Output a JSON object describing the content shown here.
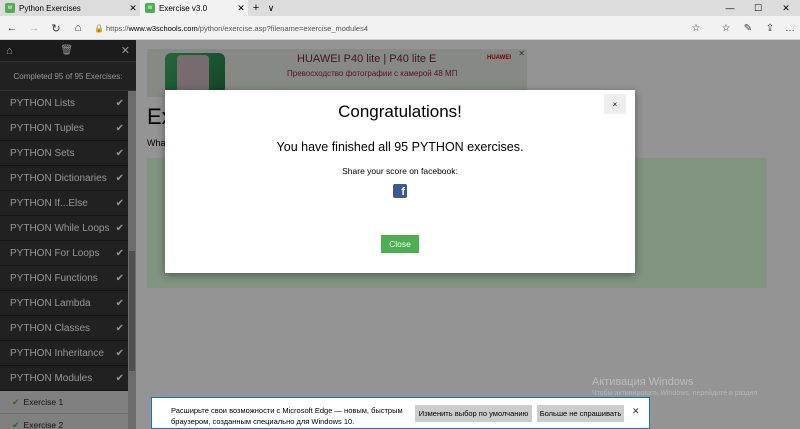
{
  "browser": {
    "tabs": [
      {
        "label": "Python Exercises",
        "favicon_color": "#4CAF50"
      },
      {
        "label": "Exercise v3.0",
        "favicon_color": "#4CAF50"
      }
    ],
    "new_tab": "+",
    "tab_list": "∨",
    "window_controls": [
      "—",
      "☐",
      "✕"
    ],
    "url_prefix": "https://",
    "url_domain": "www.w3schools.com",
    "url_path": "/python/exercise.asp?filename=exercise_modules4",
    "nav_icons": [
      "←",
      "→",
      "↻",
      "⌂"
    ],
    "toolbar_icons": [
      "☆",
      "☆",
      "✎",
      "⇪",
      "…"
    ]
  },
  "sidebar": {
    "home_icon": "⌂",
    "trash_icon": "🗑",
    "close_icon": "✕",
    "progress": "Completed 95 of 95 Exercises:",
    "items": [
      {
        "label": "PYTHON Lists"
      },
      {
        "label": "PYTHON Tuples"
      },
      {
        "label": "PYTHON Sets"
      },
      {
        "label": "PYTHON Dictionaries"
      },
      {
        "label": "PYTHON If...Else"
      },
      {
        "label": "PYTHON While Loops"
      },
      {
        "label": "PYTHON For Loops"
      },
      {
        "label": "PYTHON Functions"
      },
      {
        "label": "PYTHON Lambda"
      },
      {
        "label": "PYTHON Classes"
      },
      {
        "label": "PYTHON Inheritance"
      },
      {
        "label": "PYTHON Modules"
      }
    ],
    "sub_items": [
      {
        "label": "Exercise 1"
      },
      {
        "label": "Exercise 2"
      }
    ],
    "check": "✔"
  },
  "page": {
    "heading": "Ex",
    "question": "What",
    "ad": {
      "title": "HUAWEI P40 lite | P40 lite E",
      "subtitle": "Превосходство фотографии с камерой 48 МП",
      "brand": "HUAWEI",
      "close": "✕"
    }
  },
  "modal": {
    "title": "Congratulations!",
    "close": "×",
    "message": "You have finished all 95 PYTHON exercises.",
    "share": "Share your score on facebook:",
    "facebook_icon": "f",
    "close_button": "Close"
  },
  "edge_notification": {
    "text": "Расширьте свои возможности с Microsoft Edge — новым, быстрым браузером, созданным специально для Windows 10.",
    "primary_button": "Изменить выбор по умолчанию",
    "secondary_button": "Больше не спрашивать",
    "close": "✕"
  },
  "watermark": {
    "title": "Активация Windows",
    "subtitle": "Чтобы активировать Windows, перейдите в раздел \"Параметры\"."
  },
  "colors": {
    "accent_green": "#4CAF50",
    "sidebar_bg": "#2f2f2f",
    "facebook_blue": "#3b5998",
    "edge_blue": "#0078d7"
  }
}
